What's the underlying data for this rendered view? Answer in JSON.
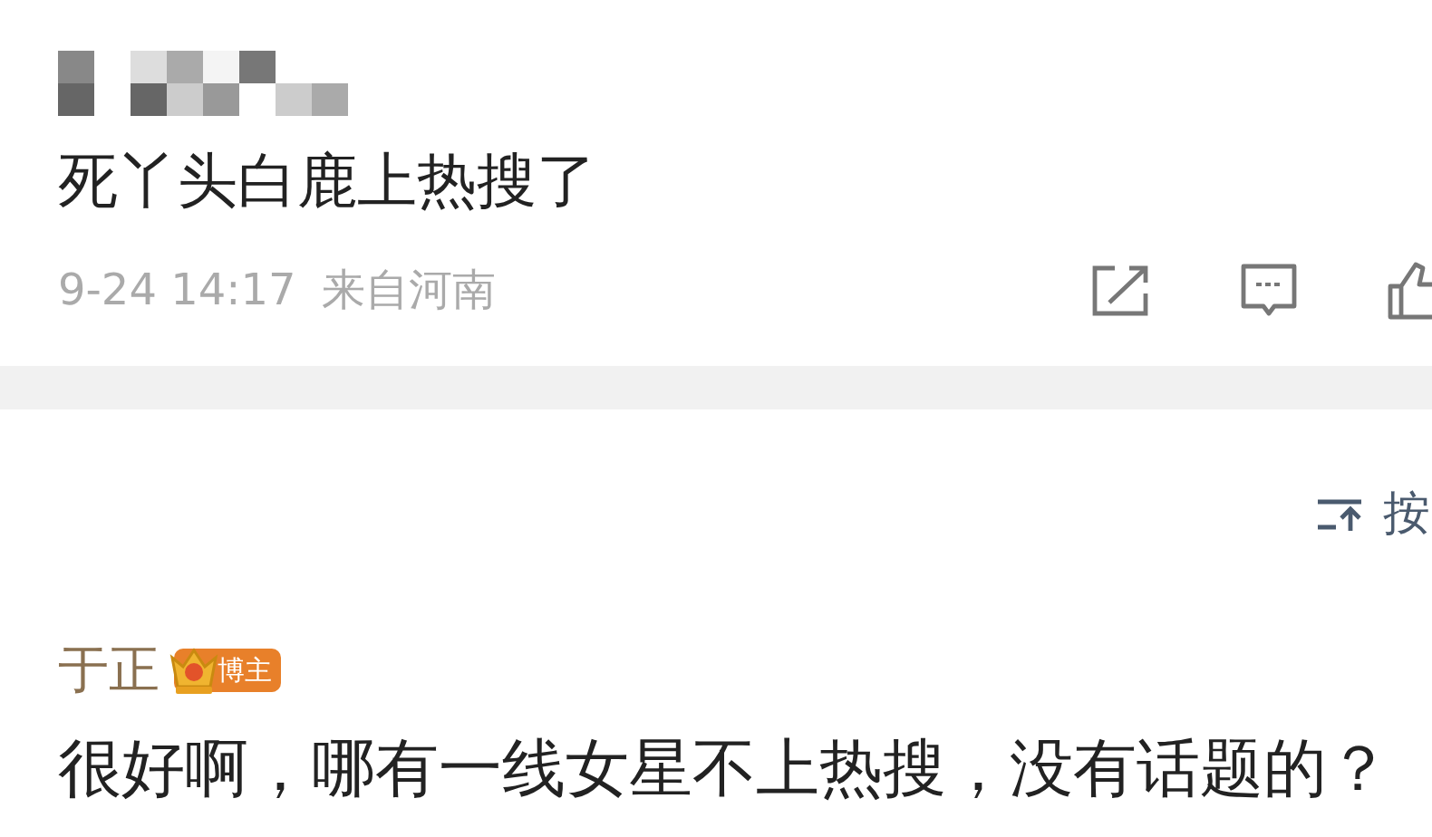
{
  "post": {
    "author_hidden": true,
    "text": "死丫头白鹿上热搜了",
    "time": "9-24 14:17",
    "location": "来自河南"
  },
  "sort": {
    "label": "按"
  },
  "comments": [
    {
      "author": "于正",
      "badge": "博主",
      "text": "很好啊，哪有一线女星不上热搜，没有话题的？"
    }
  ]
}
